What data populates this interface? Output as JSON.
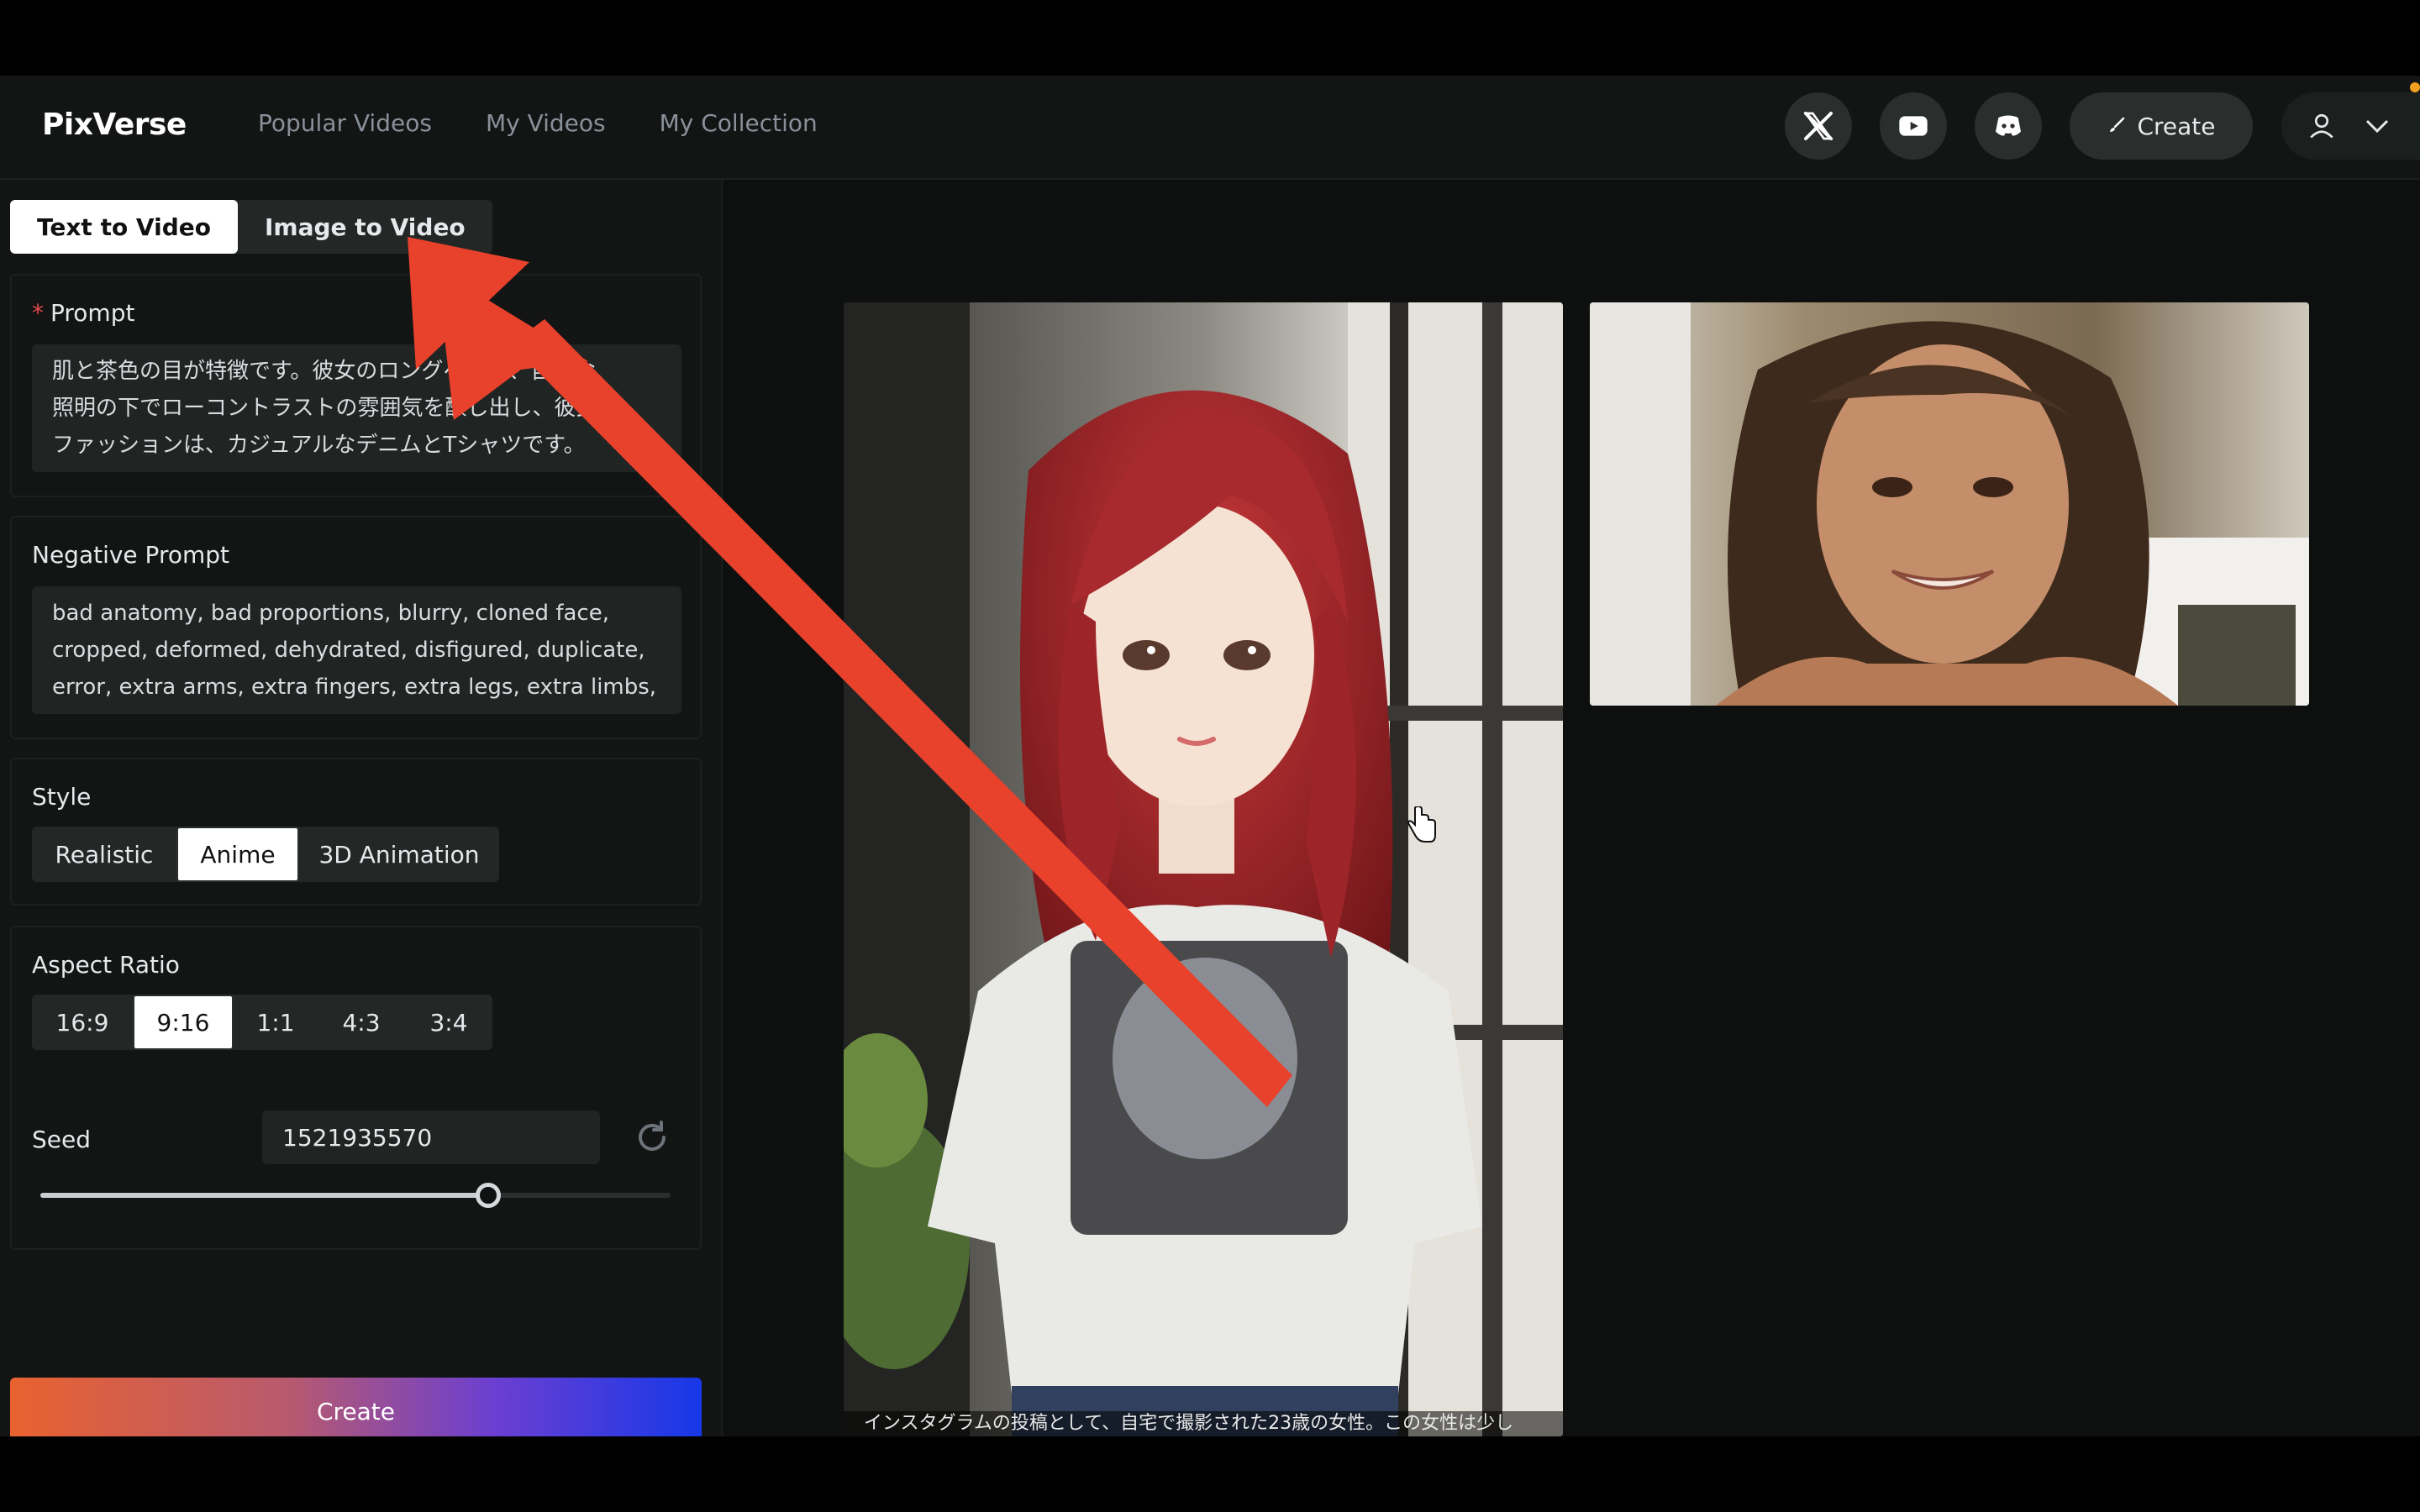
{
  "header": {
    "logo": "PixVerse",
    "nav": [
      "Popular Videos",
      "My Videos",
      "My Collection"
    ],
    "social_icons": [
      "x-logo-icon",
      "youtube-icon",
      "discord-icon"
    ],
    "create_label": "Create",
    "user_icon": "user-icon",
    "dropdown_icon": "chevron-down-icon"
  },
  "sidebar": {
    "mode_tabs": {
      "text_to_video": "Text to Video",
      "image_to_video": "Image to Video",
      "active": "Text to Video"
    },
    "prompt": {
      "label": "Prompt",
      "required_mark": "*",
      "lines": [
        "肌と茶色の目が特徴です。彼女のロングヘアは、自然な",
        "照明の下でローコントラストの雰囲気を醸し出し、彼女の",
        "ファッションは、カジュアルなデニムとTシャツです。"
      ]
    },
    "negative_prompt": {
      "label": "Negative Prompt",
      "lines": [
        "bad anatomy, bad proportions, blurry, cloned face,",
        "cropped, deformed, dehydrated, disfigured, duplicate,",
        "error, extra arms, extra fingers, extra legs, extra limbs,"
      ]
    },
    "style": {
      "label": "Style",
      "options": [
        "Realistic",
        "Anime",
        "3D Animation"
      ],
      "selected": "Anime"
    },
    "aspect_ratio": {
      "label": "Aspect Ratio",
      "options": [
        "16:9",
        "9:16",
        "1:1",
        "4:3",
        "3:4"
      ],
      "selected": "9:16"
    },
    "seed": {
      "label": "Seed",
      "value": "1521935570",
      "slider_fraction": 0.71,
      "refresh_icon": "refresh-icon"
    },
    "create_label": "Create",
    "create_gradient": [
      "#e9622f",
      "#6b3fd1",
      "#1638e8"
    ]
  },
  "gallery": {
    "items": [
      {
        "kind": "anime-portrait-thumbnail",
        "caption": "インスタグラムの投稿として、自宅で撮影された23歳の女性。この女性は少し"
      },
      {
        "kind": "realistic-portrait-thumbnail"
      }
    ]
  },
  "annotation": {
    "arrow_color": "#e8412c",
    "cursor_icon": "hand-pointer-icon"
  }
}
